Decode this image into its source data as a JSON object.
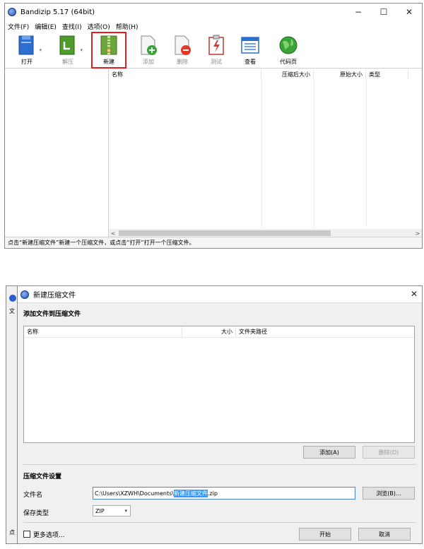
{
  "main_window": {
    "title": "Bandizip 5.17 (64bit)",
    "controls": {
      "minimize": "−",
      "maximize": "☐",
      "close": "✕"
    },
    "menu": [
      "文件(F)",
      "编辑(E)",
      "查找(I)",
      "选项(O)",
      "帮助(H)"
    ],
    "toolbar": [
      {
        "label": "打开",
        "icon": "open-archive-icon",
        "enabled": true,
        "dropdown": true
      },
      {
        "label": "解压",
        "icon": "extract-icon",
        "enabled": false,
        "dropdown": true
      },
      {
        "label": "新建",
        "icon": "new-archive-icon",
        "enabled": true,
        "highlighted": true
      },
      {
        "label": "添加",
        "icon": "add-file-icon",
        "enabled": false
      },
      {
        "label": "删除",
        "icon": "delete-file-icon",
        "enabled": false
      },
      {
        "label": "测试",
        "icon": "test-icon",
        "enabled": false
      },
      {
        "label": "查看",
        "icon": "view-icon",
        "enabled": true
      },
      {
        "label": "代码页",
        "icon": "codepage-globe-icon",
        "enabled": true
      }
    ],
    "columns": [
      "名称",
      "压缩后大小",
      "原始大小",
      "类型"
    ],
    "scroll_left": "<",
    "scroll_right": ">",
    "status_text": "点击“新建压缩文件”新建一个压缩文件，或点击“打开”打开一个压缩文件。"
  },
  "behind_window": {
    "icon_text": "文",
    "bottom_text": "点"
  },
  "new_archive_dialog": {
    "title": "新建压缩文件",
    "close": "✕",
    "add_section_title": "添加文件到压缩文件",
    "file_columns": [
      "名称",
      "大小",
      "文件夹路径"
    ],
    "add_button": "添加(A)",
    "delete_button": "删除(D)",
    "settings_title": "压缩文件设置",
    "filename_label": "文件名",
    "filename_prefix": "C:\\Users\\XZWH\\Documents\\",
    "filename_selected": "新建压缩文件",
    "filename_suffix": ".zip",
    "browse_button": "浏览(B)...",
    "save_type_label": "保存类型",
    "save_type_value": "ZIP",
    "more_options_label": "更多选项...",
    "more_options_checked": false,
    "start_button": "开始",
    "cancel_button": "取消"
  }
}
